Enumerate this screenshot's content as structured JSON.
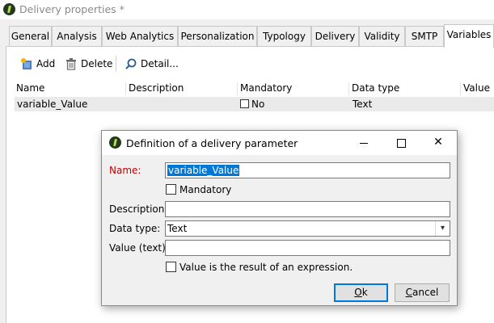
{
  "window": {
    "title": "Delivery properties *"
  },
  "tabs": [
    {
      "label": "General"
    },
    {
      "label": "Analysis"
    },
    {
      "label": "Web Analytics"
    },
    {
      "label": "Personalization"
    },
    {
      "label": "Typology"
    },
    {
      "label": "Delivery"
    },
    {
      "label": "Validity"
    },
    {
      "label": "SMTP"
    },
    {
      "label": "Variables"
    }
  ],
  "toolbar": {
    "add_label": "Add",
    "delete_label": "Delete",
    "detail_label": "Detail..."
  },
  "grid": {
    "columns": [
      "Name",
      "Description",
      "Mandatory",
      "Data type",
      "Value"
    ],
    "rows": [
      {
        "name": "variable_Value",
        "description": "",
        "mandatory_label": "No",
        "data_type": "Text",
        "value": ""
      }
    ]
  },
  "dialog": {
    "title": "Definition of a delivery parameter",
    "name_label": "Name:",
    "name_value": "variable_Value",
    "mandatory_label": "Mandatory",
    "description_label": "Description:",
    "description_value": "",
    "datatype_label": "Data type:",
    "datatype_value": "Text",
    "value_label": "Value (text):",
    "value_value": "",
    "expression_label": "Value is the result of an expression.",
    "ok_first": "O",
    "ok_rest": "k",
    "cancel_first": "C",
    "cancel_rest": "ancel",
    "minimize_glyph": "",
    "maximize_glyph": "",
    "close_glyph": "✕"
  },
  "colors": {
    "selection": "#0078d7",
    "required_label": "#c00000"
  }
}
